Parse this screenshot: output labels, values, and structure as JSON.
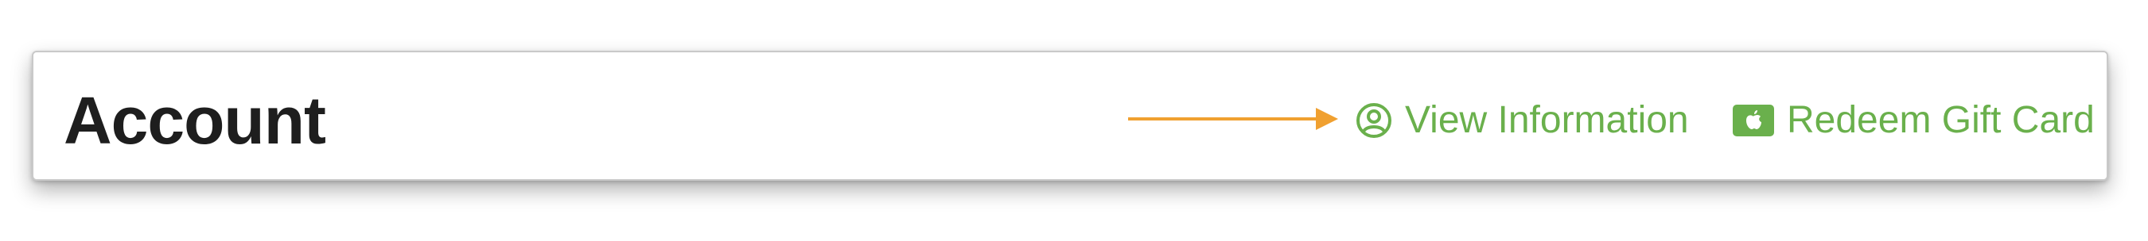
{
  "account_header": {
    "title": "Account",
    "annotation_arrow": {
      "color": "#f0a030",
      "points_to": "view-information-link"
    },
    "links": {
      "view_information": {
        "label": "View Information",
        "icon": "person-circle-icon"
      },
      "redeem_gift_card": {
        "label": "Redeem Gift Card",
        "icon": "apple-gift-card-icon"
      }
    },
    "colors": {
      "title": "#1e1e1e",
      "link": "#6ab04c",
      "background": "#ffffff"
    }
  }
}
